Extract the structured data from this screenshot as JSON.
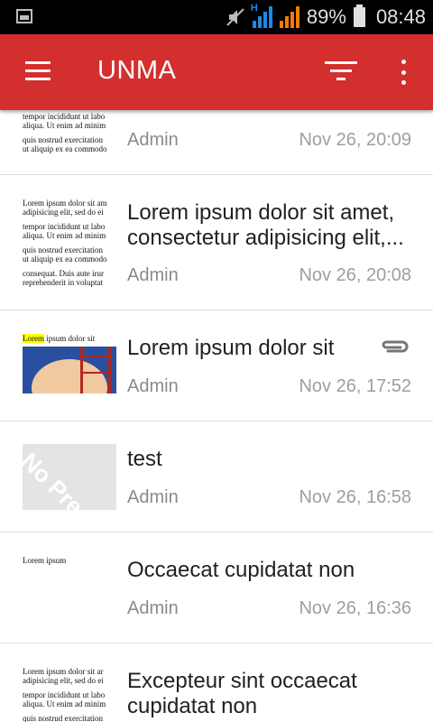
{
  "status_bar": {
    "battery_percent": "89%",
    "time": "08:48",
    "network_type": "H",
    "icons": [
      "image-icon",
      "mute-icon",
      "signal-icon",
      "signal-icon",
      "battery-icon"
    ]
  },
  "app_bar": {
    "title": "UNMA",
    "color": "#d32f2f",
    "icons": [
      "menu-icon",
      "filter-icon",
      "more-vert-icon"
    ]
  },
  "messages": [
    {
      "title": "",
      "author": "Admin",
      "date": "Nov 26, 20:09",
      "attachment": false,
      "thumb": [
        "tempor incididunt ut labo",
        "aliqua. Ut enim ad minim",
        "quis nostrud exercitation",
        "ut aliquip ex ea commodo"
      ]
    },
    {
      "title": "Lorem ipsum dolor sit amet, consectetur adipisicing elit,...",
      "author": "Admin",
      "date": "Nov 26, 20:08",
      "attachment": false,
      "thumb": [
        "Lorem ipsum dolor sit am",
        "adipisicing elit, sed do ei",
        "tempor incididunt ut labo",
        "aliqua. Ut enim ad minim",
        "quis nostrud exercitation",
        "ut aliquip ex ea commodo",
        "consequat. Duis aute irur",
        "reprehenderit in voluptat"
      ]
    },
    {
      "title": "Lorem ipsum dolor sit",
      "author": "Admin",
      "date": "Nov 26, 17:52",
      "attachment": true,
      "thumb_highlight": "Lorem",
      "thumb_rest": " ipsum dolor sit"
    },
    {
      "title": "test",
      "author": "Admin",
      "date": "Nov 26, 16:58",
      "attachment": false,
      "thumb_placeholder": "No Pre"
    },
    {
      "title": "Occaecat cupidatat non",
      "author": "Admin",
      "date": "Nov 26, 16:36",
      "attachment": false,
      "thumb_text": "Lorem ipsum"
    },
    {
      "title": "Excepteur sint occaecat cupidatat non",
      "author": "",
      "date": "",
      "attachment": false,
      "thumb": [
        "Lorem ipsum dolor sit ar",
        "adipisicing elit, sed do ei",
        "tempor incididunt ut labo",
        "aliqua. Ut enim ad minim",
        "quis nostrud exercitation"
      ]
    }
  ]
}
